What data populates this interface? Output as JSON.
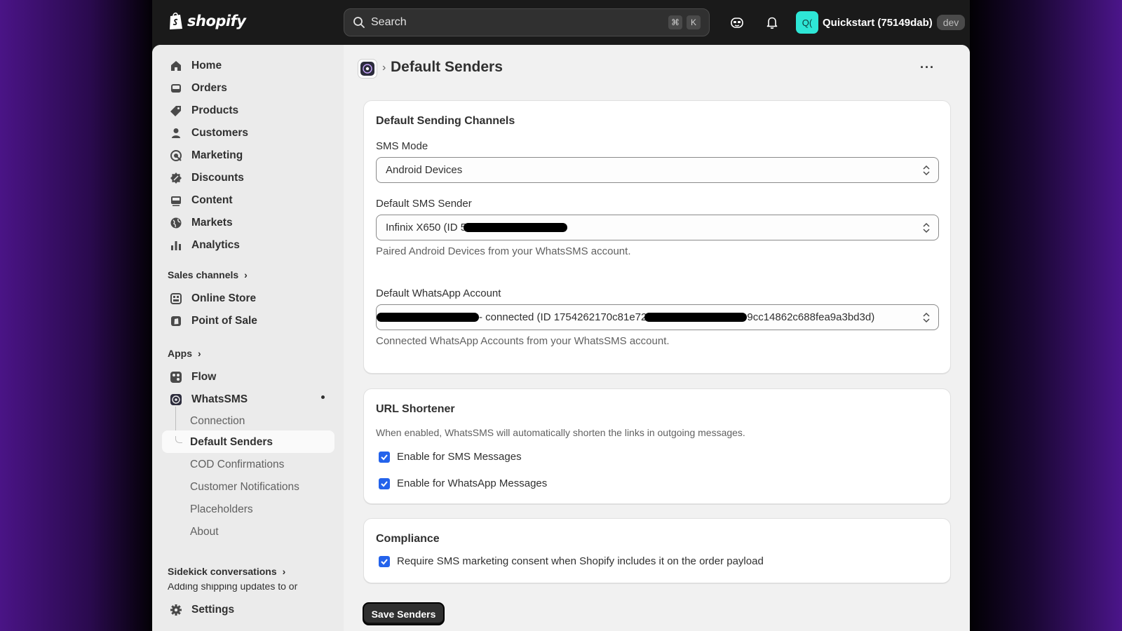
{
  "topbar": {
    "logo_text": "shopify",
    "search_placeholder": "Search",
    "shortcut_keys": [
      "⌘",
      "K"
    ],
    "avatar_initials": "Q(",
    "store_name": "Quickstart (75149dab)",
    "store_badge": "dev"
  },
  "sidebar": {
    "main_items": [
      {
        "label": "Home",
        "icon": "home-icon"
      },
      {
        "label": "Orders",
        "icon": "inbox-icon"
      },
      {
        "label": "Products",
        "icon": "tag-icon"
      },
      {
        "label": "Customers",
        "icon": "person-icon"
      },
      {
        "label": "Marketing",
        "icon": "target-icon"
      },
      {
        "label": "Discounts",
        "icon": "discount-icon"
      },
      {
        "label": "Content",
        "icon": "content-icon"
      },
      {
        "label": "Markets",
        "icon": "globe-icon"
      },
      {
        "label": "Analytics",
        "icon": "bar-chart-icon"
      }
    ],
    "sales_channels_heading": "Sales channels",
    "sales_channels": [
      {
        "label": "Online Store",
        "icon": "store-icon"
      },
      {
        "label": "Point of Sale",
        "icon": "pos-icon"
      }
    ],
    "apps_heading": "Apps",
    "apps": [
      {
        "label": "Flow",
        "icon": "flow-icon"
      },
      {
        "label": "WhatsSMS",
        "icon": "whatssms-icon"
      }
    ],
    "whatssms_subitems": [
      "Connection",
      "Default Senders",
      "COD Confirmations",
      "Customer Notifications",
      "Placeholders",
      "About"
    ],
    "sidekick_heading": "Sidekick conversations",
    "sidekick_preview": "Adding shipping updates to or",
    "settings_label": "Settings"
  },
  "page": {
    "title": "Default Senders"
  },
  "channels_card": {
    "title": "Default Sending Channels",
    "sms_mode_label": "SMS Mode",
    "sms_mode_value": "Android Devices",
    "sms_sender_label": "Default SMS Sender",
    "sms_sender_value": "Infinix X650 (ID 5",
    "sms_sender_help": "Paired Android Devices from your WhatsSMS account.",
    "whatsapp_label": "Default WhatsApp Account",
    "whatsapp_value_mid": "- connected (ID 1754262170c81e72",
    "whatsapp_value_end": "9cc14862c688fea9a3bd3d)",
    "whatsapp_help": "Connected WhatsApp Accounts from your WhatsSMS account."
  },
  "url_card": {
    "title": "URL Shortener",
    "description": "When enabled, WhatsSMS will automatically shorten the links in outgoing messages.",
    "sms_checkbox": "Enable for SMS Messages",
    "sms_checked": true,
    "whatsapp_checkbox": "Enable for WhatsApp Messages",
    "whatsapp_checked": true
  },
  "compliance_card": {
    "title": "Compliance",
    "consent_checkbox": "Require SMS marketing consent when Shopify includes it on the order payload",
    "consent_checked": true
  },
  "save_button": "Save Senders",
  "colors": {
    "accent_checkbox": "#2463eb",
    "avatar_bg": "#2ee6d6",
    "topbar_bg": "#1a1a1a"
  }
}
